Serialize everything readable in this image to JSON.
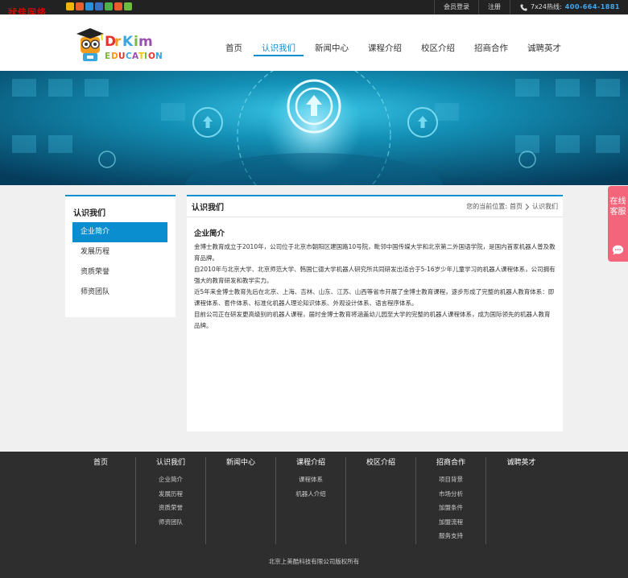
{
  "topbar": {
    "brand_text": "狀佳网络",
    "login": "会员登录",
    "register": "注册",
    "hotline_label": "7x24热线:",
    "hotline_number": "400-664-1881"
  },
  "header": {
    "nav": [
      {
        "label": "首页"
      },
      {
        "label": "认识我们",
        "active": true
      },
      {
        "label": "新闻中心"
      },
      {
        "label": "课程介绍"
      },
      {
        "label": "校区介绍"
      },
      {
        "label": "招商合作"
      },
      {
        "label": "诚聘英才"
      }
    ]
  },
  "sidebar": {
    "title": "认识我们",
    "items": [
      {
        "label": "企业简介",
        "active": true
      },
      {
        "label": "发展历程"
      },
      {
        "label": "资质荣誉"
      },
      {
        "label": "师资团队"
      }
    ]
  },
  "content": {
    "title": "认识我们",
    "breadcrumb_prefix": "您的当前位置:",
    "breadcrumb_home": "首页",
    "breadcrumb_current": "认识我们",
    "section_title": "企业简介",
    "paragraphs": [
      "金博士教育成立于2010年，公司位于北京市朝阳区建国路10号院，毗邻中国传媒大学和北京第二外国语学院，是国内首家机器人普及教育品牌。",
      "自2010年与北京大学、北京师范大学、韩国仁德大学机器人研究所共同研发出适合于5-16岁少年儿童学习的机器人课程体系，公司拥有强大的教育研发和教学实力。",
      "近5年来金博士教育先后在北京、上海、吉林、山东、江苏、山西等省市开展了金博士教育课程，逐步形成了完整的机器人教育体系：即课程体系、套件体系、标准化机器人理论知识体系、外观设计体系、语言程序体系。",
      "目前公司正在研发更高级别的机器人课程，届时金博士教育将涵盖幼儿园至大学的完整的机器人课程体系，成为国际领先的机器人教育品牌。"
    ]
  },
  "float_service": {
    "label": "在线客服"
  },
  "footer": {
    "columns": [
      {
        "title": "首页",
        "links": []
      },
      {
        "title": "认识我们",
        "links": [
          "企业简介",
          "发展历程",
          "资质荣誉",
          "师资团队"
        ]
      },
      {
        "title": "新闻中心",
        "links": []
      },
      {
        "title": "课程介绍",
        "links": [
          "课程体系",
          "机器人介绍"
        ]
      },
      {
        "title": "校区介绍",
        "links": []
      },
      {
        "title": "招商合作",
        "links": [
          "项目背景",
          "市场分析",
          "加盟条件",
          "加盟流程",
          "服务支持"
        ]
      },
      {
        "title": "诚聘英才",
        "links": []
      }
    ],
    "copyright": "北京上美酷科技有限公司版权所有"
  },
  "colors": {
    "accent": "#0b8ed0",
    "topbar_bg": "#222222",
    "footer_bg": "#2e2e2e",
    "float_bg": "#f3657a",
    "hotline": "#3fa9f5"
  }
}
